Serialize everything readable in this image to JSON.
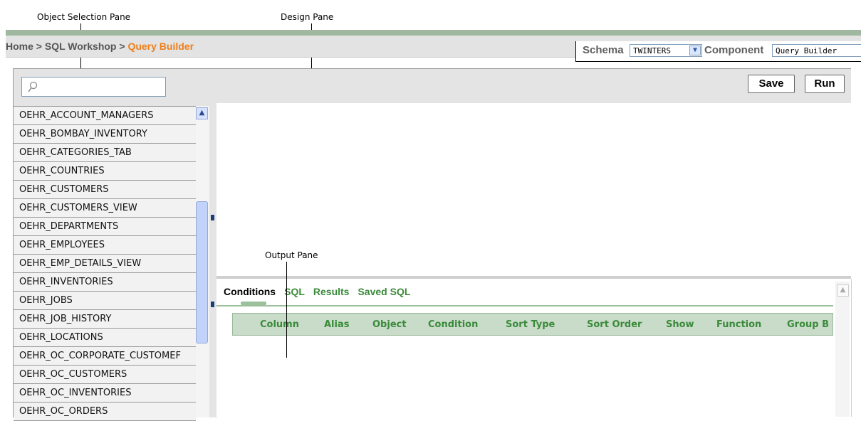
{
  "callouts": {
    "object_selection": "Object Selection Pane",
    "design": "Design Pane",
    "output": "Output Pane"
  },
  "breadcrumb": {
    "home": "Home",
    "sep": ">",
    "workshop": "SQL Workshop",
    "current": "Query Builder"
  },
  "toolbar": {
    "schema_label": "Schema",
    "schema_value": "TWINTERS",
    "component_label": "Component",
    "component_value": "Query Builder",
    "save_label": "Save",
    "run_label": "Run"
  },
  "objects": [
    "OEHR_ACCOUNT_MANAGERS",
    "OEHR_BOMBAY_INVENTORY",
    "OEHR_CATEGORIES_TAB",
    "OEHR_COUNTRIES",
    "OEHR_CUSTOMERS",
    "OEHR_CUSTOMERS_VIEW",
    "OEHR_DEPARTMENTS",
    "OEHR_EMPLOYEES",
    "OEHR_EMP_DETAILS_VIEW",
    "OEHR_INVENTORIES",
    "OEHR_JOBS",
    "OEHR_JOB_HISTORY",
    "OEHR_LOCATIONS",
    "OEHR_OC_CORPORATE_CUSTOMEF",
    "OEHR_OC_CUSTOMERS",
    "OEHR_OC_INVENTORIES",
    "OEHR_OC_ORDERS"
  ],
  "output_tabs": [
    "Conditions",
    "SQL",
    "Results",
    "Saved SQL"
  ],
  "conditions_columns": [
    "Column",
    "Alias",
    "Object",
    "Condition",
    "Sort Type",
    "Sort Order",
    "Show",
    "Function",
    "Group B"
  ],
  "colors": {
    "accent_orange": "#ef7f1a",
    "tab_green": "#3a8a3a",
    "header_green": "#c9dcc9"
  },
  "icons": {
    "search": "magnifier",
    "scroll_up": "chevron-up",
    "dropdown": "chevron-down"
  }
}
